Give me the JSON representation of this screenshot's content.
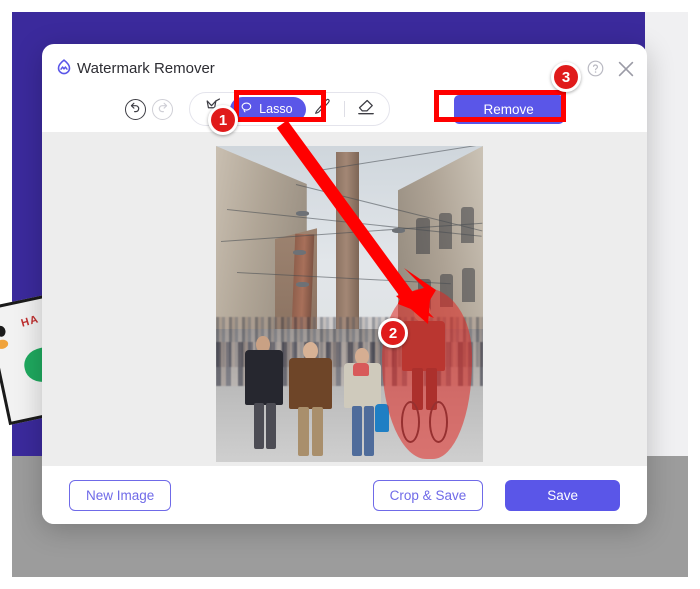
{
  "app": {
    "title": "Watermark Remover",
    "logo_icon": "watermark-remover-logo-icon"
  },
  "header": {
    "help_icon": "help-circle-icon",
    "close_icon": "close-icon"
  },
  "toolbar": {
    "undo_icon": "undo-arrow-icon",
    "redo_icon": "redo-arrow-icon",
    "magic_wand_icon": "magic-wand-icon",
    "lasso_label": "Lasso",
    "lasso_icon": "lasso-icon",
    "brush_icon": "brush-icon",
    "eraser_icon": "eraser-icon",
    "remove_label": "Remove",
    "active_tool": "Lasso"
  },
  "canvas": {
    "selection_tool": "lasso",
    "selection_color": "#e22822",
    "photo_description": "Bologna street scene with Two Towers and crowd"
  },
  "footer": {
    "new_image_label": "New Image",
    "crop_save_label": "Crop & Save",
    "save_label": "Save"
  },
  "annotations": {
    "step1": "1",
    "step2": "2",
    "step3": "3",
    "accent_color": "#ff0000"
  },
  "background": {
    "card_text": "HA"
  },
  "colors": {
    "brand_purple": "#5a56e8",
    "backdrop_purple": "#3b2a9c",
    "backdrop_gray": "#9c9c9c",
    "canvas_gray": "#ededed",
    "annotation_red": "#ff0000"
  }
}
